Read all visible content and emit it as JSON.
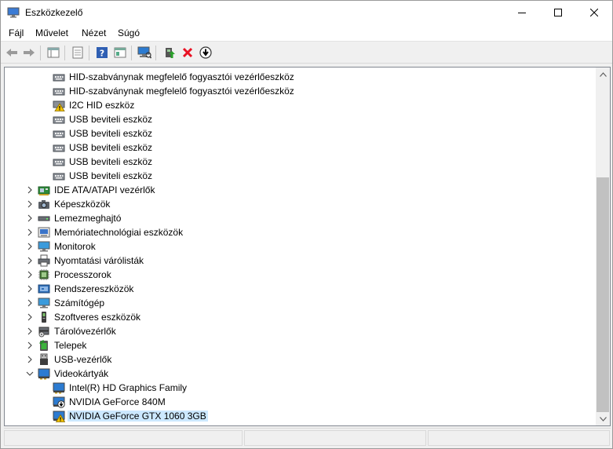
{
  "window": {
    "title": "Eszközkezelő"
  },
  "menu": [
    {
      "label": "Fájl"
    },
    {
      "label": "Művelet"
    },
    {
      "label": "Nézet"
    },
    {
      "label": "Súgó"
    }
  ],
  "tree": [
    {
      "label": "HID-szabványnak megfelelő fogyasztói vezérlőeszköz",
      "icon": "hid-device-icon",
      "level": 2
    },
    {
      "label": "HID-szabványnak megfelelő fogyasztói vezérlőeszköz",
      "icon": "hid-device-icon",
      "level": 2
    },
    {
      "label": "I2C HID eszköz",
      "icon": "warning-device-icon",
      "level": 2
    },
    {
      "label": "USB beviteli eszköz",
      "icon": "hid-device-icon",
      "level": 2
    },
    {
      "label": "USB beviteli eszköz",
      "icon": "hid-device-icon",
      "level": 2
    },
    {
      "label": "USB beviteli eszköz",
      "icon": "hid-device-icon",
      "level": 2
    },
    {
      "label": "USB beviteli eszköz",
      "icon": "hid-device-icon",
      "level": 2
    },
    {
      "label": "USB beviteli eszköz",
      "icon": "hid-device-icon",
      "level": 2
    },
    {
      "label": "IDE ATA/ATAPI vezérlők",
      "icon": "ide-controller-icon",
      "level": 1,
      "expander": "collapsed"
    },
    {
      "label": "Képeszközök",
      "icon": "camera-icon",
      "level": 1,
      "expander": "collapsed"
    },
    {
      "label": "Lemezmeghajtó",
      "icon": "disk-drive-icon",
      "level": 1,
      "expander": "collapsed"
    },
    {
      "label": "Memóriatechnológiai eszközök",
      "icon": "memory-device-icon",
      "level": 1,
      "expander": "collapsed"
    },
    {
      "label": "Monitorok",
      "icon": "monitor-icon",
      "level": 1,
      "expander": "collapsed"
    },
    {
      "label": "Nyomtatási várólisták",
      "icon": "printer-icon",
      "level": 1,
      "expander": "collapsed"
    },
    {
      "label": "Processzorok",
      "icon": "processor-icon",
      "level": 1,
      "expander": "collapsed"
    },
    {
      "label": "Rendszereszközök",
      "icon": "system-device-icon",
      "level": 1,
      "expander": "collapsed"
    },
    {
      "label": "Számítógép",
      "icon": "computer-icon",
      "level": 1,
      "expander": "collapsed"
    },
    {
      "label": "Szoftveres eszközök",
      "icon": "software-device-icon",
      "level": 1,
      "expander": "collapsed"
    },
    {
      "label": "Tárolóvezérlők",
      "icon": "storage-controller-icon",
      "level": 1,
      "expander": "collapsed"
    },
    {
      "label": "Telepek",
      "icon": "battery-icon",
      "level": 1,
      "expander": "collapsed"
    },
    {
      "label": "USB-vezérlők",
      "icon": "usb-icon",
      "level": 1,
      "expander": "collapsed"
    },
    {
      "label": "Videokártyák",
      "icon": "display-adapter-icon",
      "level": 1,
      "expander": "expanded"
    },
    {
      "label": "Intel(R) HD Graphics Family",
      "icon": "display-adapter-icon",
      "level": 2
    },
    {
      "label": "NVIDIA GeForce 840M",
      "icon": "display-adapter-down-icon",
      "level": 2
    },
    {
      "label": "NVIDIA GeForce GTX 1060 3GB",
      "icon": "display-adapter-warning-icon",
      "level": 2,
      "selected": true
    }
  ],
  "colors": {
    "selection": "#cce8ff",
    "accent": "#1e78c8",
    "warning": "#f2c200",
    "error": "#e81123"
  }
}
